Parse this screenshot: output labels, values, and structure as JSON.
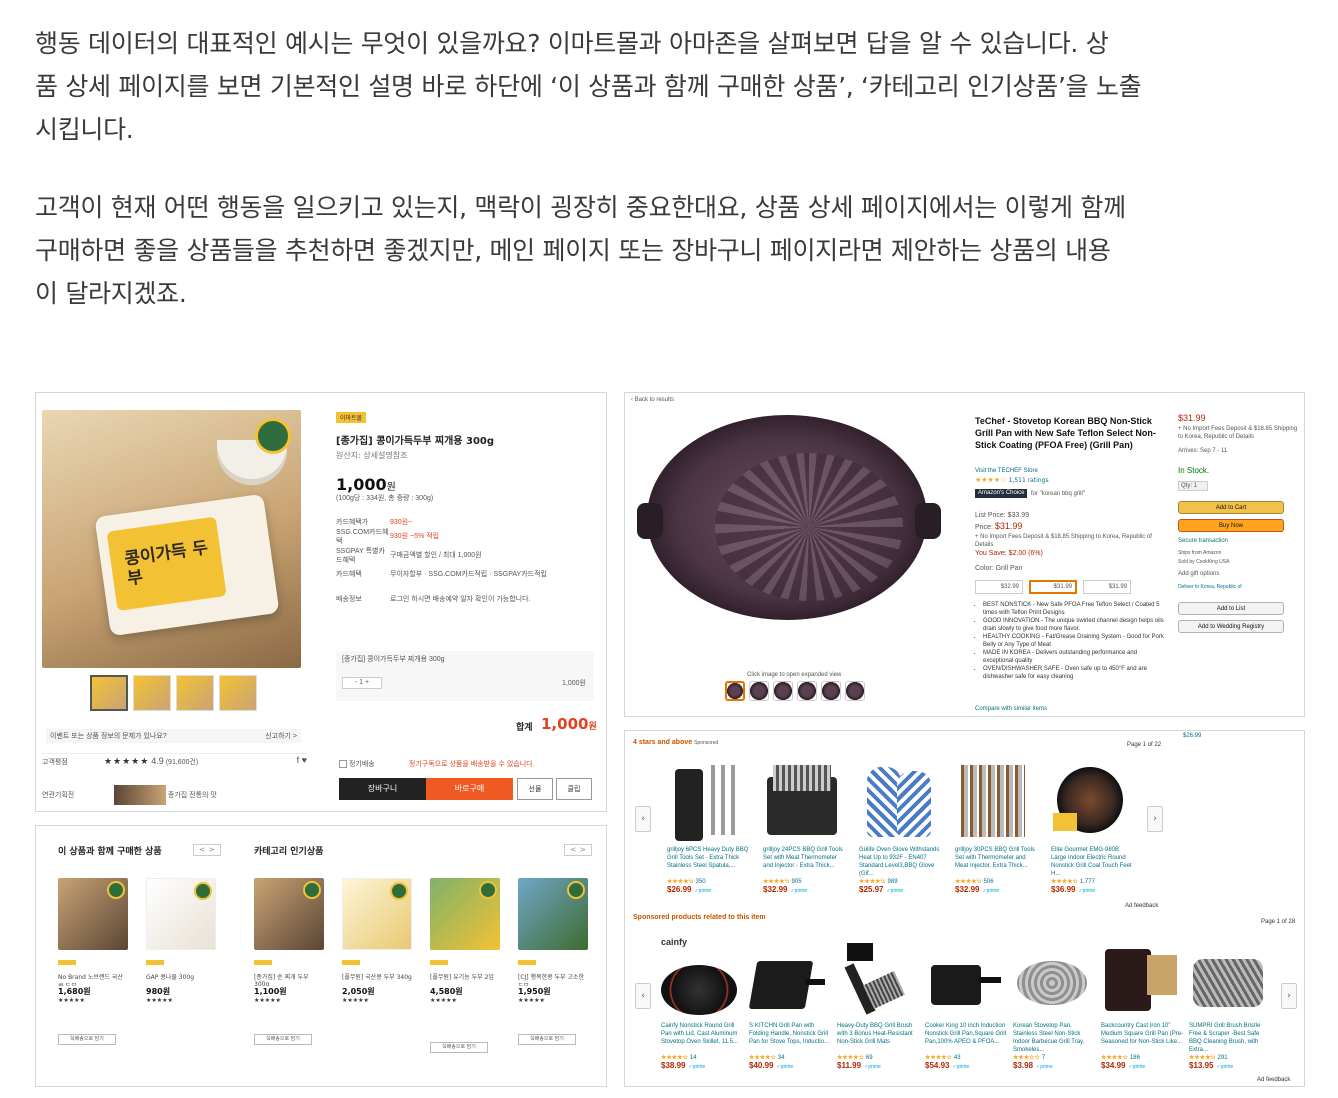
{
  "article": {
    "para1": [
      "행동 데이터의 대표적인 예시는 무엇이 있을까요? 이마트몰과 아마존을 살펴보면 답을 알 수 있습니다. 상",
      "품 상세 페이지를 보면 기본적인 설명 바로 하단에 ‘이 상품과 함께 구매한 상품’, ‘카테고리 인기상품’을 노출",
      "시킵니다."
    ],
    "para2": [
      "고객이 현재 어떤 행동을 일으키고 있는지, 맥락이 굉장히 중요한대요, 상품 상세 페이지에서는 이렇게 함께",
      "구매하면 좋을 상품들을 추천하면 좋겠지만, 메인 페이지 또는 장바구니 페이지라면 제안하는 상품의 내용",
      "이 달라지겠죠."
    ]
  },
  "emart_product": {
    "tag": "이마트몰",
    "title": "[종가집] 콩이가득두부 찌개용 300g",
    "origin": "원산지: 상세설명참조",
    "price": "1,000",
    "price_unit": "원",
    "unit_price": "(100g당 : 334원, 총 중량 : 300g)",
    "package_label": "콩이가득 두부",
    "rows": [
      {
        "k": "카드혜택가",
        "v": "930원~",
        "red": true
      },
      {
        "k": "SSG.COM카드혜택",
        "v": "930원 ~5% 적립",
        "red": true
      },
      {
        "k": "SSGPAY 특별카드혜택",
        "v": "구매금액별 할인 / 최대 1,000원",
        "red": false
      },
      {
        "k": "카드혜택",
        "v": "무이자할부 · SSG.COM카드적립 · SSGPAY카드적립",
        "red": false
      },
      {
        "k": "배송정보",
        "v": "로그인 하시면 배송예약 일자 확인이 가능합니다.",
        "red": false
      }
    ],
    "option_name": "[종가집] 콩이가득두부 찌개용 300g",
    "qty": "1",
    "line_price": "1,000원",
    "total_label": "합계",
    "total_price": "1,000",
    "total_unit": "원",
    "rating_label": "고객평점",
    "rating_stars": "★★★★★",
    "rating_value": "4.9",
    "rating_count": "(91,600건)",
    "report_link": "신고하기 >",
    "notice": "이벤트 또는 상품 정보의 문제가 있나요?",
    "subscribe": "정기배송",
    "subscribe_note": "정기구독으로 상품을 배송받을 수 있습니다.",
    "partner_label": "연관기획전",
    "partner_name": "종가집 전통의 맛",
    "cart_label": "장바구니",
    "buy_label": "바로구매",
    "gift_label": "선물",
    "clip_label": "클립"
  },
  "amazon_product": {
    "breadcrumb": "‹ Back to results",
    "title": "TeChef - Stovetop Korean BBQ Non-Stick Grill Pan with New Safe Teflon Select Non-Stick Coating (PFOA Free) (Grill Pan)",
    "store": "Visit the TECHEF Store",
    "stars": "★★★★☆",
    "ratings": "1,511 ratings",
    "choice": "Amazon's Choice",
    "choice_for": "for \"korean bbq grill\"",
    "list_price": "List Price: $33.99",
    "price": "$31.99",
    "price_note": "+ No Import Fees Deposit & $18.85 Shipping to Korea, Republic of Details",
    "you_save": "You Save: $2.00 (6%)",
    "color": "Color: Grill Pan",
    "variants": [
      "$32.99",
      "$31.99",
      "$31.99"
    ],
    "bullets": [
      "BEST NONSTICK - New Safe PFOA Free Teflon Select / Coated 5 times with Teflon Print Designs",
      "GOOD INNOVATION - The unique swirled channel design helps oils drain slowly to give food more flavor.",
      "HEALTHY COOKING - Fat/Grease Draining System - Good for Pork Belly or Any Type of Meat",
      "MADE IN KOREA - Delivers outstanding performance and exceptional quality",
      "OVEN/DISHWASHER SAFE - Oven safe up to 450°F and are dishwasher safe for easy cleaning"
    ],
    "compare": "Compare with similar items",
    "expand_hint": "Click image to open expanded view",
    "buybox_price": "$31.99",
    "buybox_note": "+ No Import Fees Deposit & $18.85 Shipping to Korea, Republic of Details",
    "arrives": "Arrives: Sep 7 - 11",
    "in_stock": "In Stock.",
    "qty": "Qty: 1",
    "add_cart": "Add to Cart",
    "buy_now": "Buy Now",
    "secure": "Secure transaction",
    "ships_from": "Ships from  Amazon",
    "sold_by": "Sold by  CookKing USA",
    "gift": "Add gift options",
    "deliver": "Deliver to Korea, Republic of",
    "add_list": "Add to List",
    "add_registry": "Add to Wedding Registry",
    "other_price": "$26.99"
  },
  "emart_reco": {
    "bought_together_title": "이 상품과 함께 구매한 상품",
    "popular_title": "카테고리 인기상품",
    "pager": "< >",
    "items": [
      {
        "name": "No Brand 노브랜드 국산콩 두부",
        "price": "1,680원",
        "stars": "★★★★★",
        "btn": "쓱배송으로 담기"
      },
      {
        "name": "GAP 콩나물 300g",
        "price": "980원",
        "stars": "★★★★★",
        "btn": ""
      },
      {
        "name": "[종가집] 순 찌개 두부 300g",
        "price": "1,100원",
        "stars": "★★★★★",
        "btn": "쓱배송으로 담기"
      },
      {
        "name": "[풀무원] 국산콩 두부 340g",
        "price": "2,050원",
        "stars": "★★★★★",
        "btn": ""
      },
      {
        "name": "[풀무원] 유기농 두부 2입",
        "price": "4,580원",
        "stars": "★★★★★",
        "btn": "쓱배송으로 담기"
      },
      {
        "name": "[CJ] 행복한콩 두부 고소한 두부",
        "price": "1,950원",
        "stars": "★★★★★",
        "btn": "쓱배송으로 담기"
      }
    ]
  },
  "amazon_reco": {
    "section1": "4 stars and above",
    "section1_sponsored": "Sponsored",
    "section1_page": "Page 1 of 22",
    "section2": "Sponsored products related to this item",
    "section2_page": "Page 1 of 28",
    "ad_feedback": "Ad feedback",
    "row1": [
      {
        "name": "grilljoy 6PCS Heavy Duty BBQ Grill Tools Set - Extra Thick Stainless Steel Spatula,...",
        "stars": "★★★★½",
        "count": "350",
        "price": "$26.99"
      },
      {
        "name": "grilljoy 24PCS BBQ Grill Tools Set with Meat Thermometer and Injector - Extra Thick...",
        "stars": "★★★★½",
        "count": "905",
        "price": "$32.99"
      },
      {
        "name": "Gülife Oven Glove Withstands Heat Up to 932F - EN407 Standard Level3,BBQ Glove (Gif...",
        "stars": "★★★★½",
        "count": "989",
        "price": "$25.97"
      },
      {
        "name": "grilljoy 30PCS BBQ Grill Tools Set with Thermometer and Meat Injector. Extra Thick...",
        "stars": "★★★★½",
        "count": "506",
        "price": "$32.99"
      },
      {
        "name": "Elite Gourmet EMG-980B Large Indoor Electric Round Nonstick Grill Coal Touch Feet H...",
        "stars": "★★★★☆",
        "count": "1,777",
        "price": "$36.99"
      }
    ],
    "row2": [
      {
        "name": "Cainfy Nonstick Round Grill Pan with Lid, Cast Aluminum Stovetop Oven Skillet, 11.5...",
        "stars": "★★★★☆",
        "count": "14",
        "price": "$38.99"
      },
      {
        "name": "S·KITCHN Grill Pan with Folding Handle, Nonstick Grill Pan for Stove Tops, Inductio...",
        "stars": "★★★★☆",
        "count": "34",
        "price": "$40.99"
      },
      {
        "name": "Heavy-Duty BBQ Grill Brush with 3 Bonus Heat-Resistant Non-Stick Grill Mats",
        "stars": "★★★★☆",
        "count": "69",
        "price": "$11.99"
      },
      {
        "name": "Cooker King 10 inch Induction Nonstick Grill Pan,Square Grill Pan,100% APEO & PFOA...",
        "stars": "★★★★☆",
        "count": "43",
        "price": "$54.93"
      },
      {
        "name": "Korean Stovetop Pan, Stainless Steel Non-Stick Indoor Barbecue Grill Tray, Smokeles...",
        "stars": "★★★☆☆",
        "count": "7",
        "price": "$3.98"
      },
      {
        "name": "Backcountry Cast Iron 10\" Medium Square Grill Pan (Pre-Seasoned for Non-Stick Like...",
        "stars": "★★★★☆",
        "count": "186",
        "price": "$34.99"
      },
      {
        "name": "SUMPRI Grill Brush Bristle Free & Scraper -Best Safe BBQ Cleaning Brush, with Extra...",
        "stars": "★★★★½",
        "count": "291",
        "price": "$13.95"
      }
    ],
    "prime": "✓prime",
    "cainfy_logo": "cainfy"
  }
}
